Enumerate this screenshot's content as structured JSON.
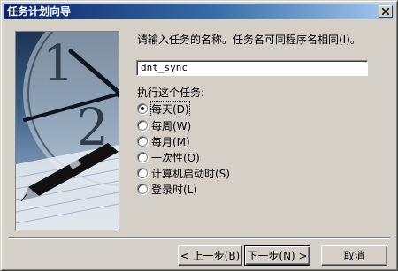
{
  "window": {
    "title": "任务计划向导"
  },
  "prompt": "请输入任务的名称。任务名可同程序名相同(I)。",
  "task_name": {
    "value": "dnt_sync"
  },
  "frequency": {
    "label": "执行这个任务:",
    "options": [
      {
        "label": "每天(D)",
        "checked": true
      },
      {
        "label": "每周(W)",
        "checked": false
      },
      {
        "label": "每月(M)",
        "checked": false
      },
      {
        "label": "一次性(O)",
        "checked": false
      },
      {
        "label": "计算机启动时(S)",
        "checked": false
      },
      {
        "label": "登录时(L)",
        "checked": false
      }
    ]
  },
  "buttons": {
    "back": "< 上一步(B)",
    "next": "下一步(N) >",
    "cancel": "取消"
  }
}
